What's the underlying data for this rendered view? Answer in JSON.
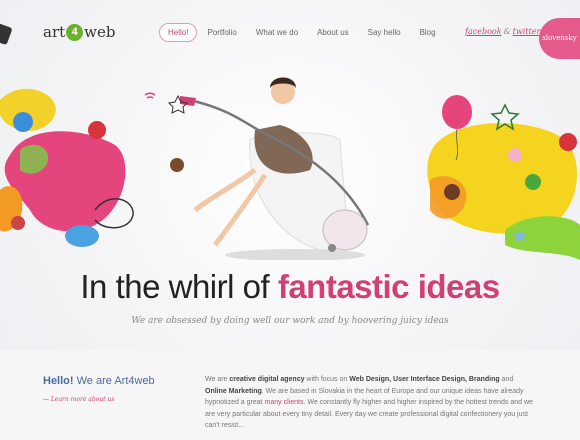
{
  "header": {
    "logo": {
      "left": "art",
      "ball": "4",
      "right": "web"
    },
    "nav": [
      {
        "label": "Hello!",
        "active": true
      },
      {
        "label": "Portfolio"
      },
      {
        "label": "What we do"
      },
      {
        "label": "About us"
      },
      {
        "label": "Say hello"
      },
      {
        "label": "Blog"
      }
    ],
    "social": {
      "facebook": "facebook",
      "amp": "&",
      "twitter": "twitter"
    },
    "language": "slovensky"
  },
  "hero": {
    "headline_plain": "In the whirl of ",
    "headline_highlight": "fantastic ideas",
    "subline": "We are obsessed by doing well our work and by hoovering juicy ideas"
  },
  "intro": {
    "hello_bold": "Hello!",
    "hello_rest": " We are Art4web",
    "learn_more": "— Learn more about us",
    "p1": "We are ",
    "p2": "creative digital agency",
    "p3": " with focus on ",
    "p4": "Web Design, User Interface Design, Branding",
    "p5": " and ",
    "p6": "Online Marketing",
    "p7": ". We are based in Slovakia in the heart of Europe and our unique ideas have already hypnotized a great ",
    "p8": "many clients",
    "p9": ". We constantly fly higher and higher inspired by the hottest trends and we are very particular about every tiny detail. Every day we create professional digital confectionery you just can't resist..."
  },
  "colors": {
    "accent": "#d23f75",
    "brand_green": "#6cb12c",
    "link_blue": "#4a6aa0"
  }
}
